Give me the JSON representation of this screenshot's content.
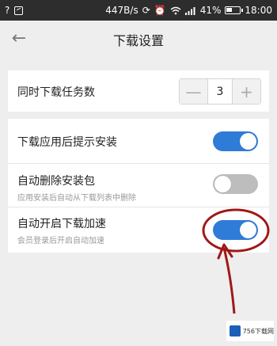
{
  "status_bar": {
    "speed": "447B/s",
    "battery_percent": "41%",
    "time": "18:00",
    "icons": [
      "question-icon",
      "gallery-icon",
      "sync-icon",
      "alarm-icon",
      "wifi-icon",
      "signal-icon",
      "battery-icon"
    ]
  },
  "header": {
    "title": "下载设置",
    "back_icon": "back-arrow-icon"
  },
  "settings": {
    "concurrent_tasks": {
      "label": "同时下载任务数",
      "minus_label": "—",
      "value": "3",
      "plus_label": "+"
    },
    "prompt_install": {
      "label": "下载应用后提示安装",
      "enabled": true
    },
    "auto_delete": {
      "label": "自动删除安装包",
      "sublabel": "应用安装后自动从下载列表中删除",
      "enabled": false
    },
    "auto_accelerate": {
      "label": "自动开启下载加速",
      "sublabel": "会员登录后开启自动加速",
      "enabled": true
    }
  },
  "watermark": {
    "text": "756下载网"
  },
  "colors": {
    "toggle_on": "#2f7bd8",
    "toggle_off": "#bdbdbd",
    "annotation": "#a01818",
    "status_bar_bg": "#2d2d2d"
  }
}
